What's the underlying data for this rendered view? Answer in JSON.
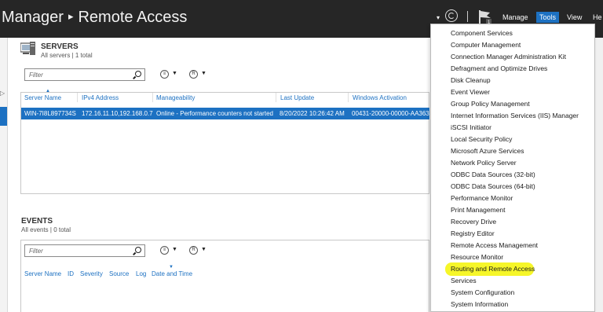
{
  "titlebar": {
    "title_part1": "Manager",
    "title_sep": "▸",
    "title_part2": "Remote Access",
    "menus": [
      "Manage",
      "Tools",
      "View",
      "He"
    ],
    "active_menu": "Tools"
  },
  "servers": {
    "title": "SERVERS",
    "subtitle": "All servers | 1 total",
    "filter_placeholder": "Filter",
    "columns": [
      "Server Name",
      "IPv4 Address",
      "Manageability",
      "Last Update",
      "Windows Activation"
    ],
    "rows": [
      {
        "server_name": "WIN-7I8L897734S",
        "ipv4": "172.16.11.10,192.168.0.7",
        "manageability": "Online - Performance counters not started",
        "last_update": "8/20/2022 10:26:42 AM",
        "activation": "00431-20000-00000-AA363"
      }
    ]
  },
  "events": {
    "title": "EVENTS",
    "subtitle": "All events | 0 total",
    "filter_placeholder": "Filter",
    "columns": [
      "Server Name",
      "ID",
      "Severity",
      "Source",
      "Log",
      "Date and Time"
    ]
  },
  "tools_menu": {
    "items": [
      "Component Services",
      "Computer Management",
      "Connection Manager Administration Kit",
      "Defragment and Optimize Drives",
      "Disk Cleanup",
      "Event Viewer",
      "Group Policy Management",
      "Internet Information Services (IIS) Manager",
      "iSCSI Initiator",
      "Local Security Policy",
      "Microsoft Azure Services",
      "Network Policy Server",
      "ODBC Data Sources (32-bit)",
      "ODBC Data Sources (64-bit)",
      "Performance Monitor",
      "Print Management",
      "Recovery Drive",
      "Registry Editor",
      "Remote Access Management",
      "Resource Monitor",
      "Routing and Remote Access",
      "Services",
      "System Configuration",
      "System Information"
    ],
    "highlighted_item": "Routing and Remote Access"
  },
  "colors": {
    "accent": "#1d71c2",
    "titlebar": "#262626",
    "highlight": "#f5f51e"
  },
  "icons": [
    "refresh-icon",
    "notifications-flag-icon",
    "search-icon",
    "servers-icon",
    "view-options-icon",
    "save-query-icon"
  ]
}
